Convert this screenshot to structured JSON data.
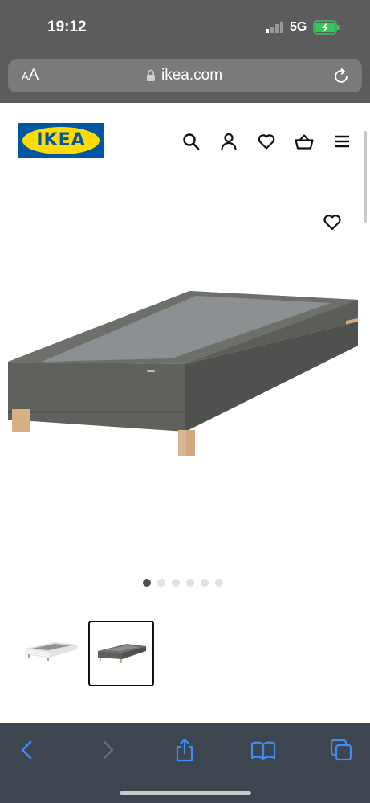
{
  "status_bar": {
    "time": "19:12",
    "network": "5G"
  },
  "browser": {
    "aa_large": "A",
    "aa_small": "A",
    "url": "ikea.com"
  },
  "header": {
    "logo_text": "IKEA",
    "icons": [
      "search-icon",
      "profile-icon",
      "heart-icon",
      "basket-icon",
      "menu-icon"
    ]
  },
  "gallery": {
    "image_count": 6,
    "active_index": 0,
    "thumbnails": [
      {
        "variant": "white",
        "selected": false
      },
      {
        "variant": "dark grey",
        "selected": true
      }
    ]
  },
  "colors": {
    "ikea_blue": "#0058a3",
    "ikea_yellow": "#ffdb00",
    "toolbar_blue": "#3d8df5",
    "upholstery_grey": "#5f615d"
  }
}
